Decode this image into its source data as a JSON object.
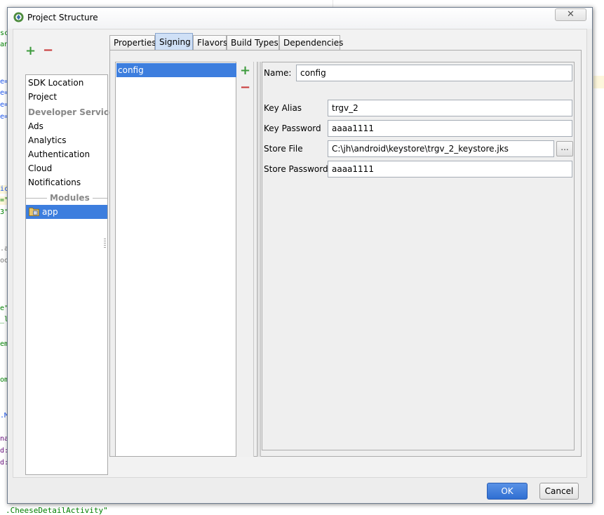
{
  "window": {
    "title": "Project Structure",
    "close_symbol": "✕"
  },
  "sidebar": {
    "add_symbol": "+",
    "remove_symbol": "−",
    "items": [
      {
        "label": "SDK Location"
      },
      {
        "label": "Project"
      },
      {
        "label": "Developer Services"
      },
      {
        "label": "Ads"
      },
      {
        "label": "Analytics"
      },
      {
        "label": "Authentication"
      },
      {
        "label": "Cloud"
      },
      {
        "label": "Notifications"
      }
    ],
    "modules_header": "Modules",
    "modules": [
      {
        "label": "app",
        "selected": true,
        "icon": "module-folder-icon"
      }
    ]
  },
  "tabs": [
    {
      "label": "Properties"
    },
    {
      "label": "Signing",
      "active": true
    },
    {
      "label": "Flavors"
    },
    {
      "label": "Build Types"
    },
    {
      "label": "Dependencies"
    }
  ],
  "signing": {
    "configs": [
      {
        "label": "config",
        "selected": true
      }
    ],
    "add_symbol": "+",
    "remove_symbol": "−",
    "name_label": "Name:",
    "name_value": "config",
    "fields": [
      {
        "label": "Key Alias",
        "value": "trgv_2"
      },
      {
        "label": "Key Password",
        "value": "aaaa1111"
      },
      {
        "label": "Store File",
        "value": "C:\\jh\\android\\keystore\\trgv_2_keystore.jks"
      },
      {
        "label": "Store Password",
        "value": "aaaa1111"
      }
    ],
    "browse_label": "..."
  },
  "buttons": {
    "ok": "OK",
    "cancel": "Cancel"
  },
  "background_editor": {
    "fragments": [
      "sc",
      "an",
      "e=",
      "e=",
      "e=",
      "e=",
      "ic",
      "=\"",
      "3\"",
      ".a",
      "oo",
      "e\"",
      "_l",
      "em",
      "om",
      ".M",
      "na",
      "d:",
      "d:"
    ],
    "bottom_line": ".CheeseDetailActivity\""
  }
}
